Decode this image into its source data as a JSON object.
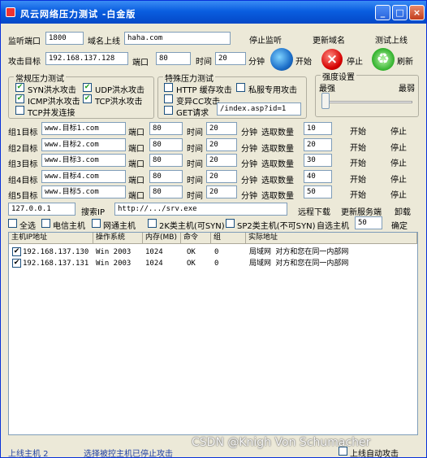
{
  "window": {
    "title": "风云网络压力测试 -白金版"
  },
  "row1": {
    "listen_port_label": "监听端口",
    "listen_port": "1800",
    "domain_label": "域名上线",
    "domain": "haha.com",
    "stop_listen": "停止监听",
    "update_domain": "更新域名",
    "test_online": "测试上线"
  },
  "row2": {
    "target_label": "攻击目标",
    "target": "192.168.137.128",
    "port_label": "端口",
    "port": "80",
    "time_label": "时间",
    "time": "20",
    "minute_label": "分钟",
    "start": "开始",
    "stop": "停止",
    "refresh": "刷新"
  },
  "normal_group": {
    "title": "常规压力测试",
    "items": [
      {
        "label": "SYN洪水攻击",
        "checked": true
      },
      {
        "label": "UDP洪水攻击",
        "checked": true
      },
      {
        "label": "ICMP洪水攻击",
        "checked": true
      },
      {
        "label": "TCP洪水攻击",
        "checked": true
      },
      {
        "label": "TCP并发连接",
        "checked": false
      }
    ]
  },
  "special_group": {
    "title": "特殊压力测试",
    "items": [
      {
        "label": "HTTP 缓存攻击",
        "checked": false
      },
      {
        "label": "私服专用攻击",
        "checked": false
      },
      {
        "label": "变异CC攻击",
        "checked": false
      },
      {
        "label": "GET请求",
        "checked": false
      }
    ],
    "get_path": "/index.asp?id=1"
  },
  "intensity": {
    "title": "强度设置",
    "strong": "最强",
    "weak": "最弱"
  },
  "groups": [
    {
      "label": "组1目标",
      "target": "www.目标1.com",
      "port": "80",
      "time": "20",
      "num": "10"
    },
    {
      "label": "组2目标",
      "target": "www.目标2.com",
      "port": "80",
      "time": "20",
      "num": "20"
    },
    {
      "label": "组3目标",
      "target": "www.目标3.com",
      "port": "80",
      "time": "20",
      "num": "30"
    },
    {
      "label": "组4目标",
      "target": "www.目标4.com",
      "port": "80",
      "time": "20",
      "num": "40"
    },
    {
      "label": "组5目标",
      "target": "www.目标5.com",
      "port": "80",
      "time": "20",
      "num": "50"
    }
  ],
  "group_labels": {
    "port": "端口",
    "time": "时间",
    "minute": "分钟",
    "select_num": "选取数量",
    "start": "开始",
    "stop": "停止"
  },
  "download": {
    "ip": "127.0.0.1",
    "search_ip": "搜索IP",
    "url": "http://.../srv.exe",
    "remote_download": "远程下载",
    "update_service": "更新服务端",
    "uninstall": "卸载"
  },
  "filters": {
    "select_all": "全选",
    "telecom": "电信主机",
    "netcom": "网通主机",
    "host2k": "2K类主机(可SYN)",
    "hostsp2": "SP2类主机(不可SYN)",
    "custom_select": "自选主机",
    "custom_num": "50",
    "confirm": "确定"
  },
  "table": {
    "headers": [
      "主机IP地址",
      "操作系统",
      "内存(MB)",
      "命令",
      "组",
      "实际地址"
    ],
    "rows": [
      {
        "checked": true,
        "ip": "192.168.137.130",
        "os": "Win 2003",
        "mem": "1024",
        "cmd": "OK",
        "group": "0",
        "addr": "局域网 对方和您在同一内部网"
      },
      {
        "checked": true,
        "ip": "192.168.137.131",
        "os": "Win 2003",
        "mem": "1024",
        "cmd": "OK",
        "group": "0",
        "addr": "局域网 对方和您在同一内部网"
      }
    ]
  },
  "statusbar": {
    "online": "上线主机 2",
    "selected": "选择被控主机已停止攻击",
    "auto_online": "上线自动攻击"
  },
  "watermark": "CSDN @Knigh Von Schumacher"
}
